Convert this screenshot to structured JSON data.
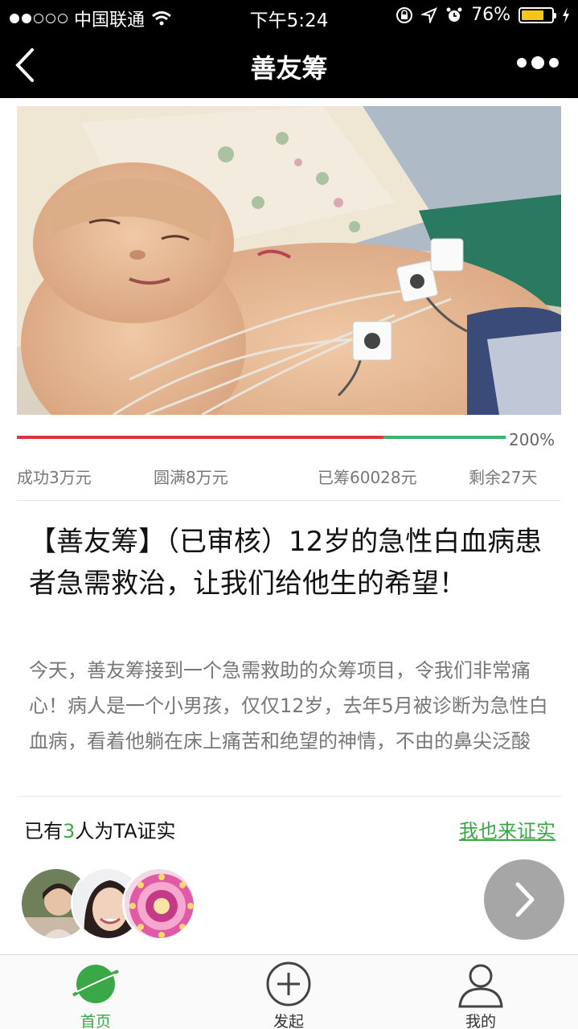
{
  "status_bar": {
    "carrier": "中国联通",
    "time": "下午5:24",
    "battery": "76%",
    "battery_level": 0.76,
    "signal_dots_filled": 2,
    "signal_dots_total": 5
  },
  "nav": {
    "title": "善友筹",
    "back_icon": "chevron-left-icon",
    "more_icon": "more-dots-icon"
  },
  "progress": {
    "label": "200%",
    "raised_fraction": 0.75,
    "colors": {
      "raised": "#d9363e",
      "remaining": "#3db46d"
    }
  },
  "stats": {
    "success": "成功3万元",
    "complete": "圆满8万元",
    "raised": "已筹60028元",
    "remaining": "剩余27天"
  },
  "project": {
    "title": "【善友筹】（已审核）12岁的急性白血病患者急需救治，让我们给他生的希望！",
    "description": "今天，善友筹接到一个急需救助的众筹项目，令我们非常痛心！病人是一个小男孩，仅仅12岁，去年5月被诊断为急性白血病，看着他躺在床上痛苦和绝望的神情，不由的鼻尖泛酸"
  },
  "verify": {
    "prefix": "已有",
    "count": "3",
    "suffix": "人为TA证实",
    "link": "我也来证实"
  },
  "tabs": [
    {
      "label": "首页",
      "icon": "planet-icon",
      "active": true
    },
    {
      "label": "发起",
      "icon": "plus-circle-icon",
      "active": false
    },
    {
      "label": "我的",
      "icon": "user-icon",
      "active": false
    }
  ],
  "colors": {
    "accent": "#3aa847",
    "nav_background": "#000000"
  }
}
